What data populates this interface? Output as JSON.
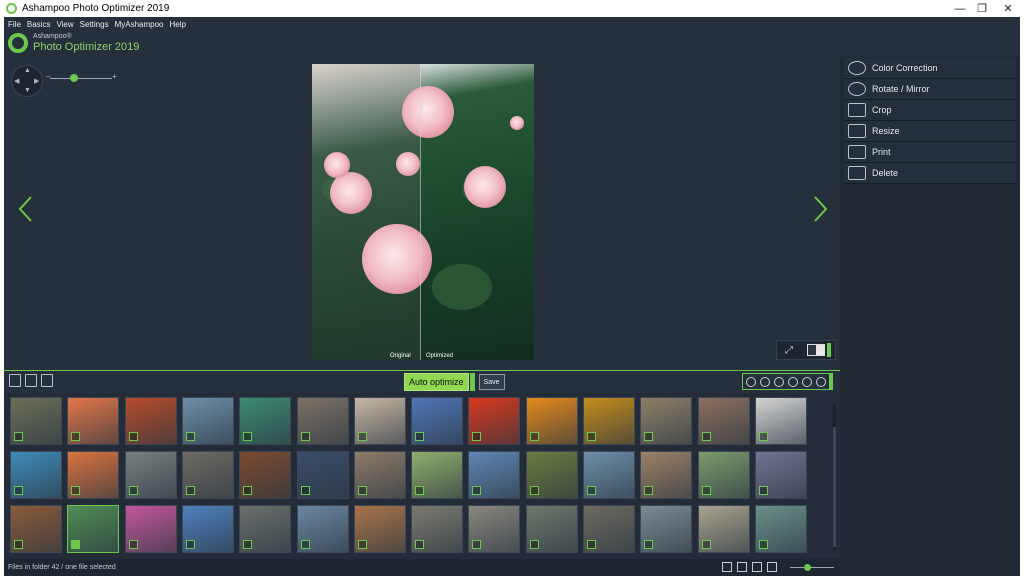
{
  "window": {
    "title": "Ashampoo Photo Optimizer 2019",
    "controls": [
      "minimize",
      "restore",
      "close"
    ]
  },
  "menu": [
    "File",
    "Basics",
    "View",
    "Settings",
    "MyAshampoo",
    "Help"
  ],
  "logo": {
    "brand": "Ashampoo®",
    "product": "Photo Optimizer 2019"
  },
  "viewer": {
    "zoom_level": 0.35,
    "label_original": "Original",
    "label_optimized": "Optimized"
  },
  "right_panel": {
    "items": [
      {
        "label": "Color Correction",
        "icon": "contrast-icon"
      },
      {
        "label": "Rotate / Mirror",
        "icon": "rotate-icon"
      },
      {
        "label": "Crop",
        "icon": "crop-icon"
      },
      {
        "label": "Resize",
        "icon": "resize-icon"
      },
      {
        "label": "Print",
        "icon": "printer-icon"
      },
      {
        "label": "Delete",
        "icon": "trash-icon"
      }
    ]
  },
  "toolbar": {
    "auto_optimize": "Auto optimize",
    "save": "Save"
  },
  "thumbnails": {
    "rows": [
      [
        "#6b6e57",
        "#e2764a",
        "#b54c2a",
        "#6e8fa8",
        "#3c8a72",
        "#7c7166",
        "#c7b7a4",
        "#4f76b6",
        "#d8391f",
        "#e48a1b",
        "#c48c1d",
        "#8c8069",
        "#8a6f5e",
        "#d4d4d4"
      ],
      [
        "#3e8bb7",
        "#d9733f",
        "#78807f",
        "#6e6a64",
        "#7b4a2f",
        "#3a4c68",
        "#8d7b68",
        "#8fae6b",
        "#5f87b3",
        "#6b7b3f",
        "#6d8fa8",
        "#9c8166",
        "#7c9a6c",
        "#6f7490"
      ],
      [
        "#8a5b3a",
        "#4f8c55",
        "#c2589a",
        "#4f80bf",
        "#6a6f6c",
        "#6c86a0",
        "#a9744a",
        "#7b7a70",
        "#89877e",
        "#6e776c",
        "#6b6a60",
        "#7c8a93",
        "#a9a38e",
        "#6b8f8a"
      ]
    ],
    "selected_row": 2,
    "selected_col": 1
  },
  "status": {
    "text": "Files in folder 42 / one file selected"
  },
  "colors": {
    "accent": "#6dc94b",
    "background": "#262f3c",
    "panel": "#1f2733"
  }
}
